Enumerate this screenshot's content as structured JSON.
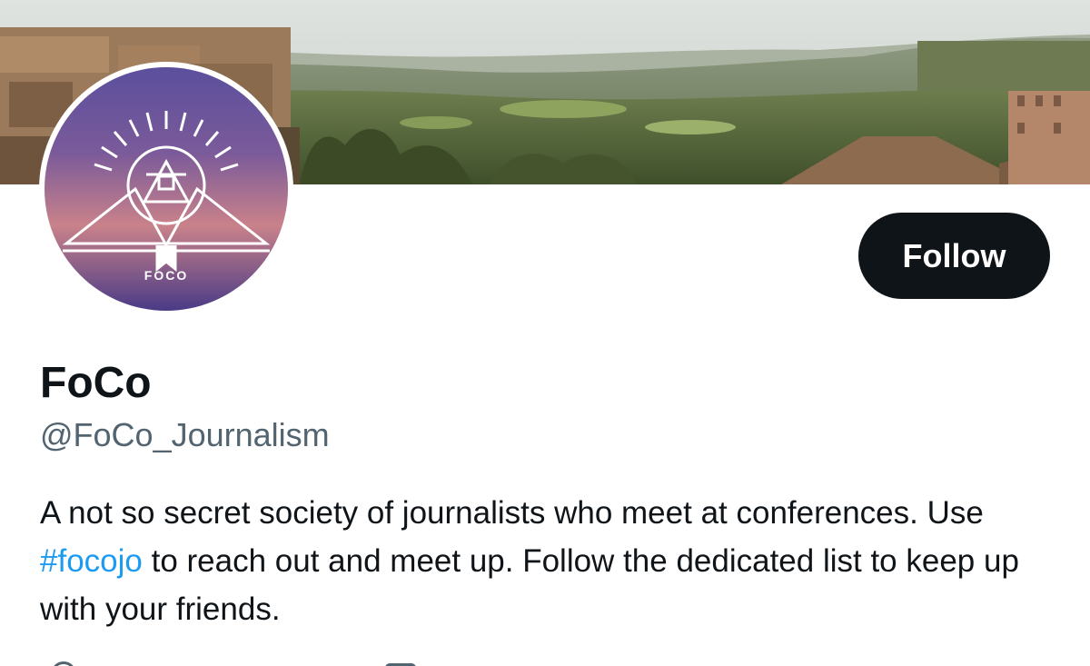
{
  "profile": {
    "banner_image": "landscape-banner",
    "avatar_image": "foco-logo",
    "avatar_logo_text": "FOCO",
    "display_name": "FoCo",
    "handle": "@FoCo_Journalism",
    "bio": {
      "part1": "A not so secret society of journalists who meet at conferences. Use ",
      "hashtag": "#focojo",
      "part2": " to reach out and meet up. Follow the dedicated list to keep up with your friends."
    },
    "meta_icons": [
      "location-icon",
      "calendar-icon"
    ]
  },
  "actions": {
    "follow_label": "Follow"
  },
  "colors": {
    "button_bg": "#0f1419",
    "button_text": "#ffffff",
    "name_text": "#0f1419",
    "secondary_text": "#536471",
    "link": "#1d9bf0"
  }
}
